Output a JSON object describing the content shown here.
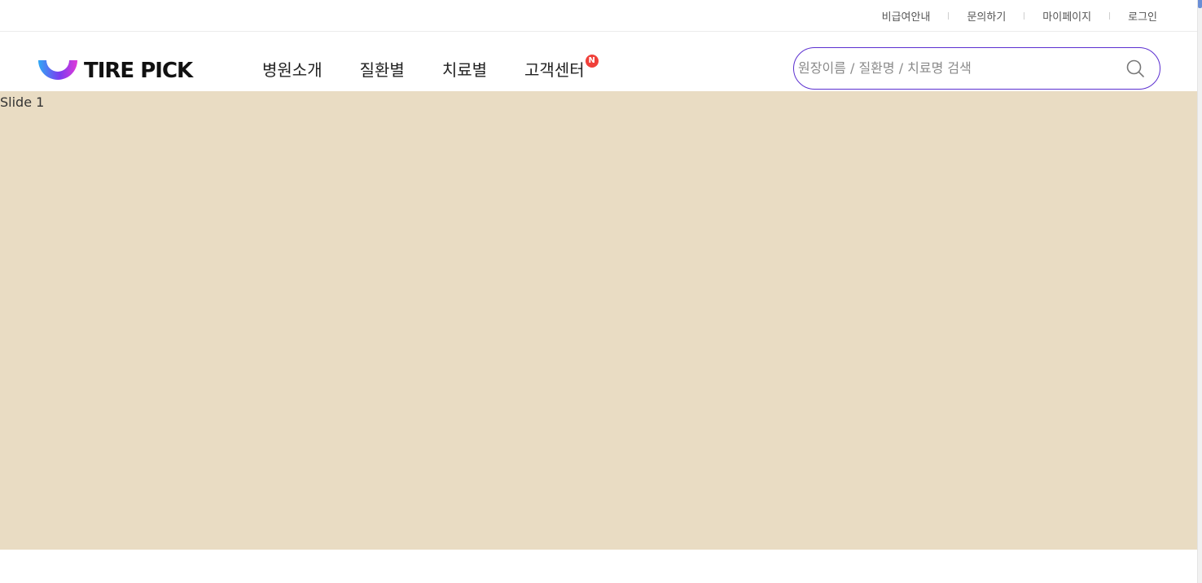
{
  "util_links": [
    "비급여안내",
    "문의하기",
    "마이페이지",
    "로그인"
  ],
  "logo": {
    "text": "TIRE PICK"
  },
  "nav": {
    "items": [
      {
        "label": "병원소개"
      },
      {
        "label": "질환별"
      },
      {
        "label": "치료별"
      },
      {
        "label": "고객센터",
        "badge": "N"
      }
    ]
  },
  "search": {
    "placeholder": "원장이름 / 질환명 / 치료명 검색",
    "value": "",
    "icon": "search-icon"
  },
  "slider": {
    "label": "Slide 1",
    "background": "#e9dcc3"
  },
  "colors": {
    "accent": "#5b2fd0",
    "badge": "#f0403a",
    "logo_gradient": [
      "#2fa8f4",
      "#7b3cf0",
      "#e13ad8"
    ]
  }
}
